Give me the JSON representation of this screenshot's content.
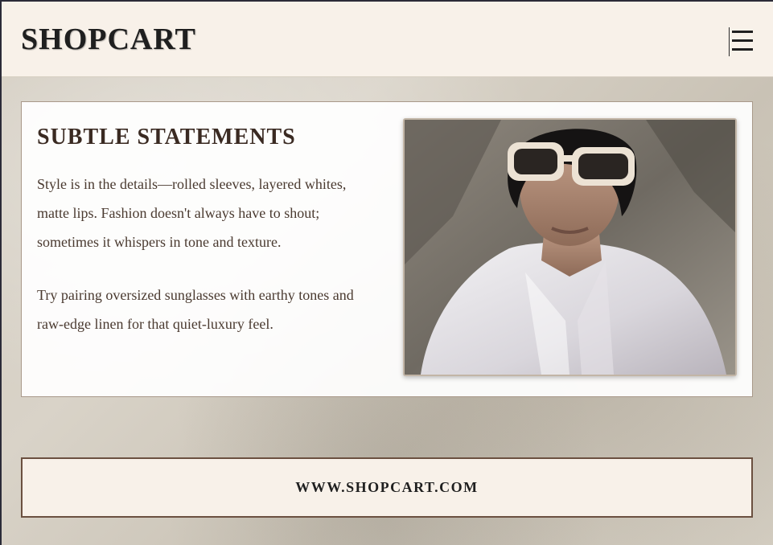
{
  "header": {
    "logo": "SHOPCART"
  },
  "menu": {
    "icon": "hamburger-menu-icon"
  },
  "feature": {
    "title": "SUBTLE STATEMENTS",
    "paragraph_1": "Style is in the details—rolled sleeves, layered whites, matte lips. Fashion doesn't always have to shout; sometimes it whispers in tone and texture.",
    "paragraph_2": "Try pairing oversized sunglasses with earthy tones and raw-edge linen for that quiet-luxury feel."
  },
  "footer": {
    "link": "WWW.SHOPCART.COM"
  },
  "colors": {
    "header_bg": "#f8f1e9",
    "title_color": "#3a2a22",
    "footer_border": "#6b5040"
  }
}
